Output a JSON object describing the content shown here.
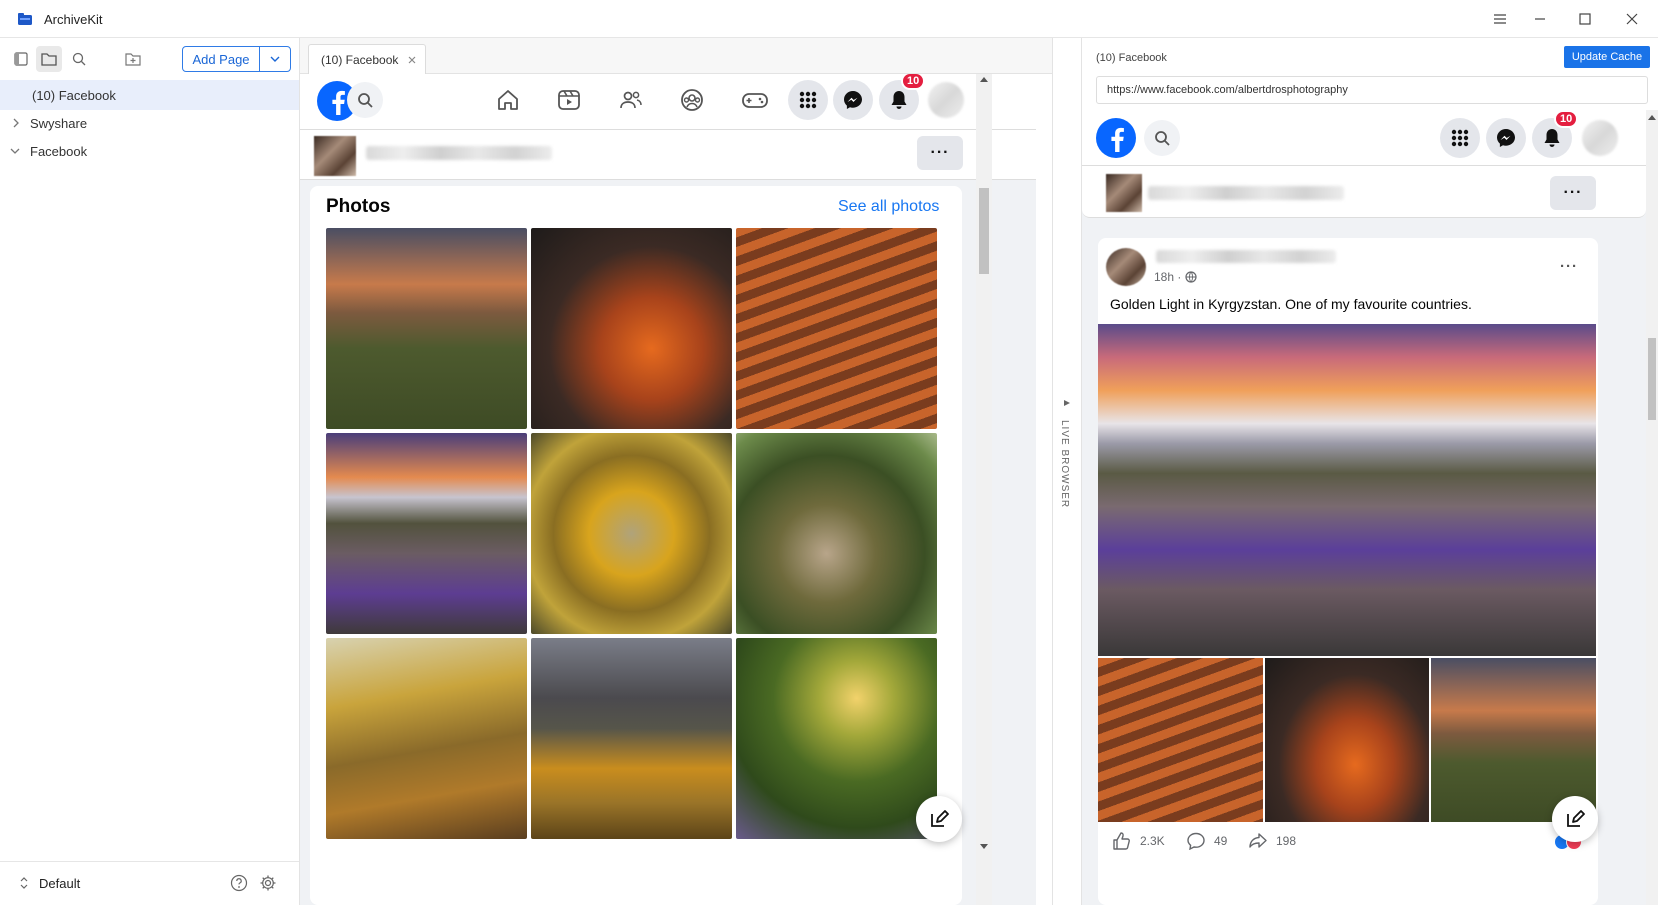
{
  "app": {
    "title": "ArchiveKit"
  },
  "sidebar": {
    "add_page_label": "Add Page",
    "tree": [
      {
        "label": "(10) Facebook",
        "selected": true
      },
      {
        "label": "Swyshare",
        "expanded": false
      },
      {
        "label": "Facebook",
        "expanded": true
      }
    ],
    "footer_label": "Default"
  },
  "tab": {
    "label": "(10) Facebook"
  },
  "facebook": {
    "notification_count": "10",
    "photos_heading": "Photos",
    "see_all_label": "See all photos"
  },
  "live_browser_label": "LIVE BROWSER",
  "right_panel": {
    "title": "(10) Facebook",
    "update_label": "Update Cache",
    "url": "https://www.facebook.com/albertdrosphotography",
    "notification_count": "10",
    "post": {
      "time": "18h ·",
      "text": "Golden Light in Kyrgyzstan. One of my favourite countries.",
      "reactions": "2.3K",
      "comments": "49",
      "shares": "198"
    }
  },
  "colors": {
    "accent": "#1a73e8",
    "fb_blue": "#0866ff",
    "badge_red": "#e41e3f"
  }
}
